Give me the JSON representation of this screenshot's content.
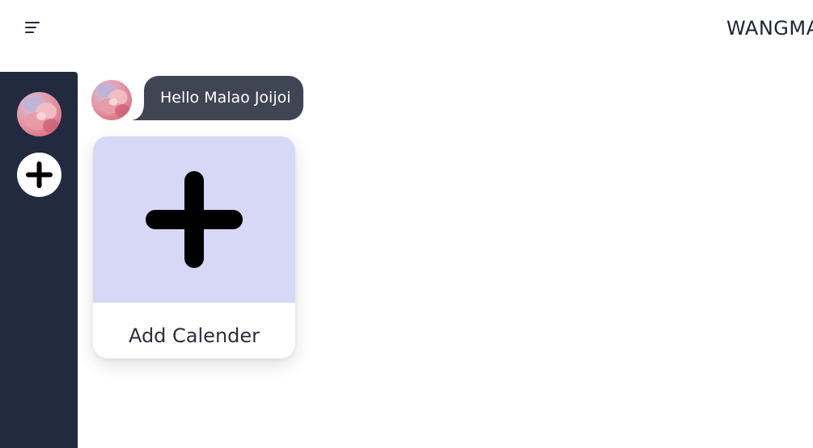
{
  "app": {
    "brand": "WANGMA"
  },
  "greeting": {
    "text": "Hello Malao Joijoi"
  },
  "card": {
    "label": "Add Calender"
  },
  "icons": {
    "menu": "menu-icon",
    "avatar": "user-avatar",
    "add": "plus-icon"
  },
  "colors": {
    "sidebar": "#222a3f",
    "bubble": "#404554",
    "card_accent": "#d7d7f6"
  }
}
